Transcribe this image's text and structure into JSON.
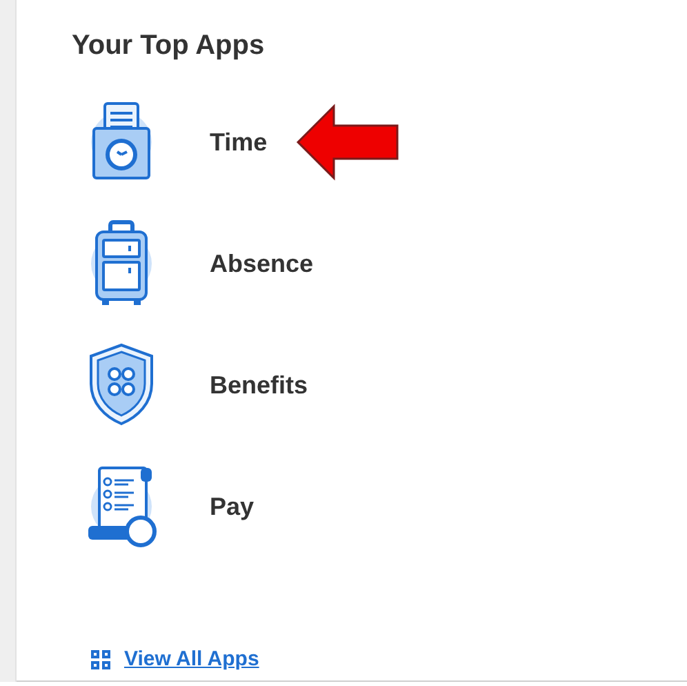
{
  "title": "Your Top Apps",
  "apps": [
    {
      "kind": "time",
      "label": "Time",
      "highlighted": true
    },
    {
      "kind": "absence",
      "label": "Absence",
      "highlighted": false
    },
    {
      "kind": "benefits",
      "label": "Benefits",
      "highlighted": false
    },
    {
      "kind": "pay",
      "label": "Pay",
      "highlighted": false
    }
  ],
  "view_all": {
    "label": "View All Apps"
  }
}
